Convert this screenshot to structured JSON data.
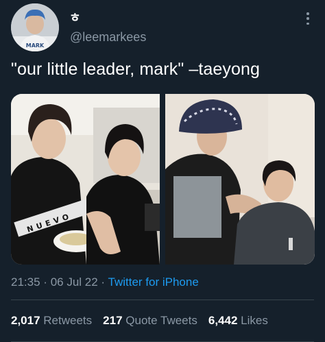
{
  "author": {
    "display_name": "ㅎ",
    "handle": "@leemarkees",
    "avatar_text": "MARK",
    "avatar_icon": "user-avatar"
  },
  "tweet": {
    "text": "\"our little leader, mark\" –taeyong",
    "time": "21:35",
    "separator": "·",
    "date": "06 Jul 22",
    "source": "Twitter for iPhone"
  },
  "media": {
    "count": 2,
    "photo_1_shirt_text": "NUEVO"
  },
  "stats": {
    "retweets_count": "2,017",
    "retweets_label": "Retweets",
    "quotes_count": "217",
    "quotes_label": "Quote Tweets",
    "likes_count": "6,442",
    "likes_label": "Likes"
  },
  "colors": {
    "background": "#15202b",
    "text_primary": "#ffffff",
    "text_secondary": "#8b98a5",
    "link": "#1d9bf0",
    "divider": "#38444d"
  }
}
